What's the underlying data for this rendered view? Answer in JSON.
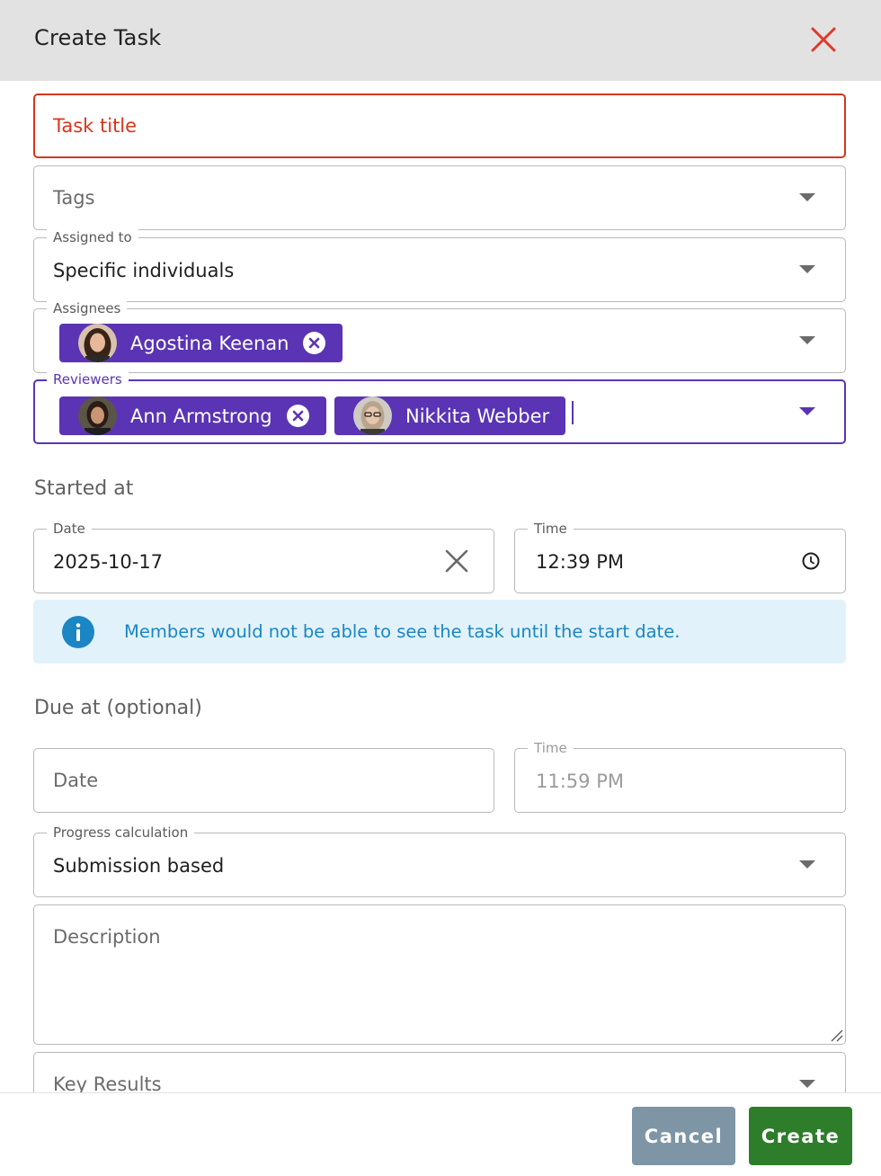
{
  "dialog": {
    "title": "Create Task"
  },
  "form": {
    "task_title": {
      "placeholder": "Task title"
    },
    "tags": {
      "placeholder": "Tags"
    },
    "assigned_to": {
      "label": "Assigned to",
      "value": "Specific individuals"
    },
    "assignees": {
      "label": "Assignees",
      "chips": [
        {
          "name": "Agostina Keenan",
          "removable": true
        }
      ]
    },
    "reviewers": {
      "label": "Reviewers",
      "chips": [
        {
          "name": "Ann Armstrong",
          "removable": true
        },
        {
          "name": "Nikkita Webber",
          "removable": false
        }
      ]
    },
    "started_at": {
      "section_title": "Started at",
      "date": {
        "label": "Date",
        "value": "2025-10-17"
      },
      "time": {
        "label": "Time",
        "value": "12:39 PM"
      },
      "info": "Members would not be able to see the task until the start date."
    },
    "due_at": {
      "section_title": "Due at (optional)",
      "date": {
        "placeholder": "Date"
      },
      "time": {
        "label": "Time",
        "value": "11:59 PM"
      }
    },
    "progress_calculation": {
      "label": "Progress calculation",
      "value": "Submission based"
    },
    "description": {
      "placeholder": "Description"
    },
    "key_results": {
      "placeholder": "Key Results"
    }
  },
  "footer": {
    "cancel_label": "Cancel",
    "create_label": "Create"
  },
  "colors": {
    "primary": "#5a34b4",
    "error": "#d7361e",
    "info": "#1a86c4",
    "create": "#2d7d2b",
    "cancel": "#7d95a5"
  }
}
